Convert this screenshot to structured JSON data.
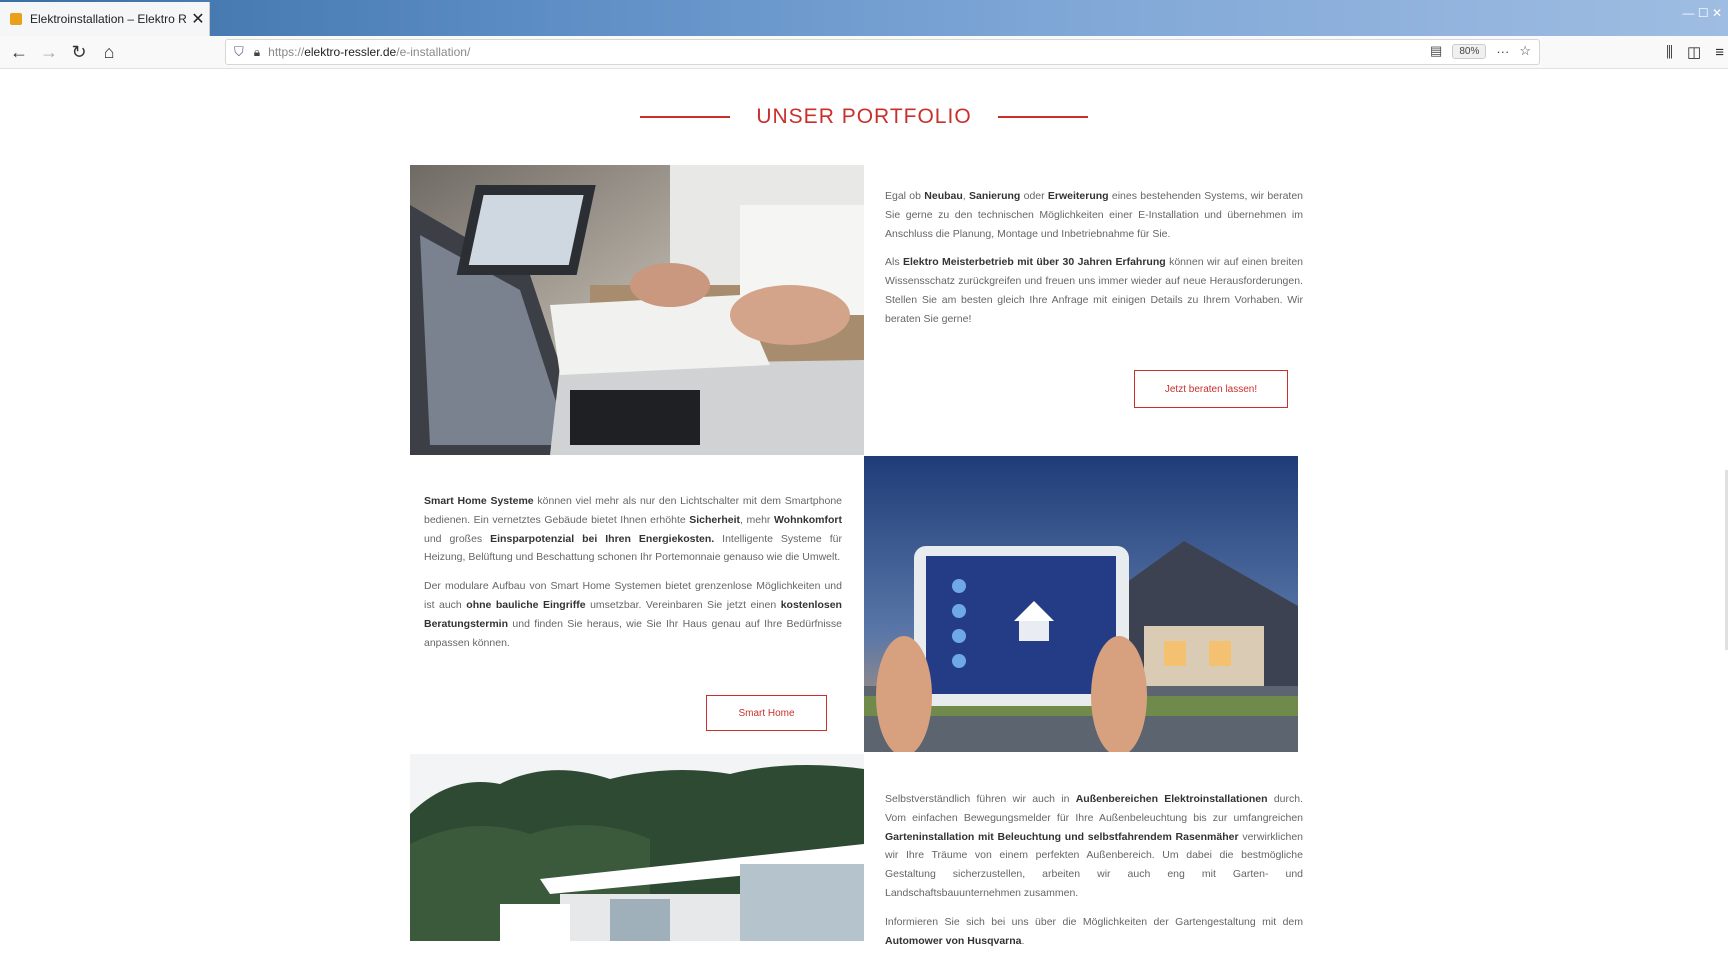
{
  "browser": {
    "tab_title": "Elektroinstallation – Elektro Re…",
    "url_prefix": "https://",
    "url_domain": "elektro-ressler.de",
    "url_path": "/e-installation/",
    "zoom": "80%",
    "icons": [
      "back-icon",
      "forward-icon",
      "reload-icon",
      "home-icon",
      "shield-icon",
      "lock-icon",
      "reader-icon",
      "more-icon",
      "bookmark-star-icon",
      "library-icon",
      "sidebar-icon",
      "menu-icon"
    ]
  },
  "page": {
    "heading": "UNSER PORTFOLIO",
    "accent_color": "#c9302c",
    "section1": {
      "p1_pre": "Egal ob ",
      "p1_b1": "Neubau",
      "p1_m1": ", ",
      "p1_b2": "Sanierung",
      "p1_m2": " oder ",
      "p1_b3": "Erweiterung",
      "p1_post": " eines bestehenden Systems, wir beraten Sie gerne zu den technischen Möglichkeiten einer E-Installation und übernehmen im Anschluss die Planung, Montage und Inbetriebnahme für Sie.",
      "p2_pre": "Als ",
      "p2_b1": "Elektro Meisterbetrieb mit über 30 Jahren Erfahrung",
      "p2_post": " können wir auf einen breiten Wissensschatz zurückgreifen und freuen uns immer wieder auf neue Herausforderungen. Stellen Sie am besten gleich Ihre Anfrage mit einigen Details zu Ihrem Vorhaben. Wir beraten Sie gerne!",
      "button": "Jetzt beraten lassen!"
    },
    "section2": {
      "p1_b1": "Smart Home Systeme",
      "p1_m1": " können viel mehr als nur den Lichtschalter mit dem Smartphone bedienen. Ein vernetztes Gebäude bietet Ihnen erhöhte ",
      "p1_b2": "Sicherheit",
      "p1_m2": ", mehr ",
      "p1_b3": "Wohnkomfort",
      "p1_m3": " und großes ",
      "p1_b4": "Einsparpotenzial bei Ihren Energiekosten.",
      "p1_post": " Intelligente Systeme für Heizung, Belüftung und Beschattung schonen Ihr Portemonnaie genauso wie die Umwelt.",
      "p2_pre": "Der modulare Aufbau von Smart Home Systemen bietet grenzenlose Möglichkeiten und ist auch ",
      "p2_b1": "ohne bauliche Eingriffe",
      "p2_m1": " umsetzbar. Vereinbaren Sie jetzt einen ",
      "p2_b2": "kostenlosen Beratungstermin",
      "p2_post": " und finden Sie heraus, wie Sie Ihr Haus genau auf Ihre Bedürfnisse anpassen können.",
      "button": "Smart Home"
    },
    "section3": {
      "p1_pre": "Selbstverständlich führen wir auch in ",
      "p1_b1": "Außenbereichen Elektroinstallationen",
      "p1_m1": " durch. Vom einfachen Bewegungsmelder für Ihre Außenbeleuchtung bis zur umfangreichen ",
      "p1_b2": "Garteninstallation mit Beleuchtung und selbstfahrendem Rasenmäher",
      "p1_post": " verwirklichen wir Ihre Träume von einem perfekten Außenbereich. Um dabei die bestmögliche Gestaltung sicherzustellen, arbeiten wir auch eng mit Garten- und Landschaftsbauunternehmen zusammen.",
      "p2_pre": "Informieren Sie sich bei uns über die Möglichkeiten der Gartengestaltung mit dem ",
      "p2_b1": "Automower von Husqvarna",
      "p2_post": "."
    }
  }
}
